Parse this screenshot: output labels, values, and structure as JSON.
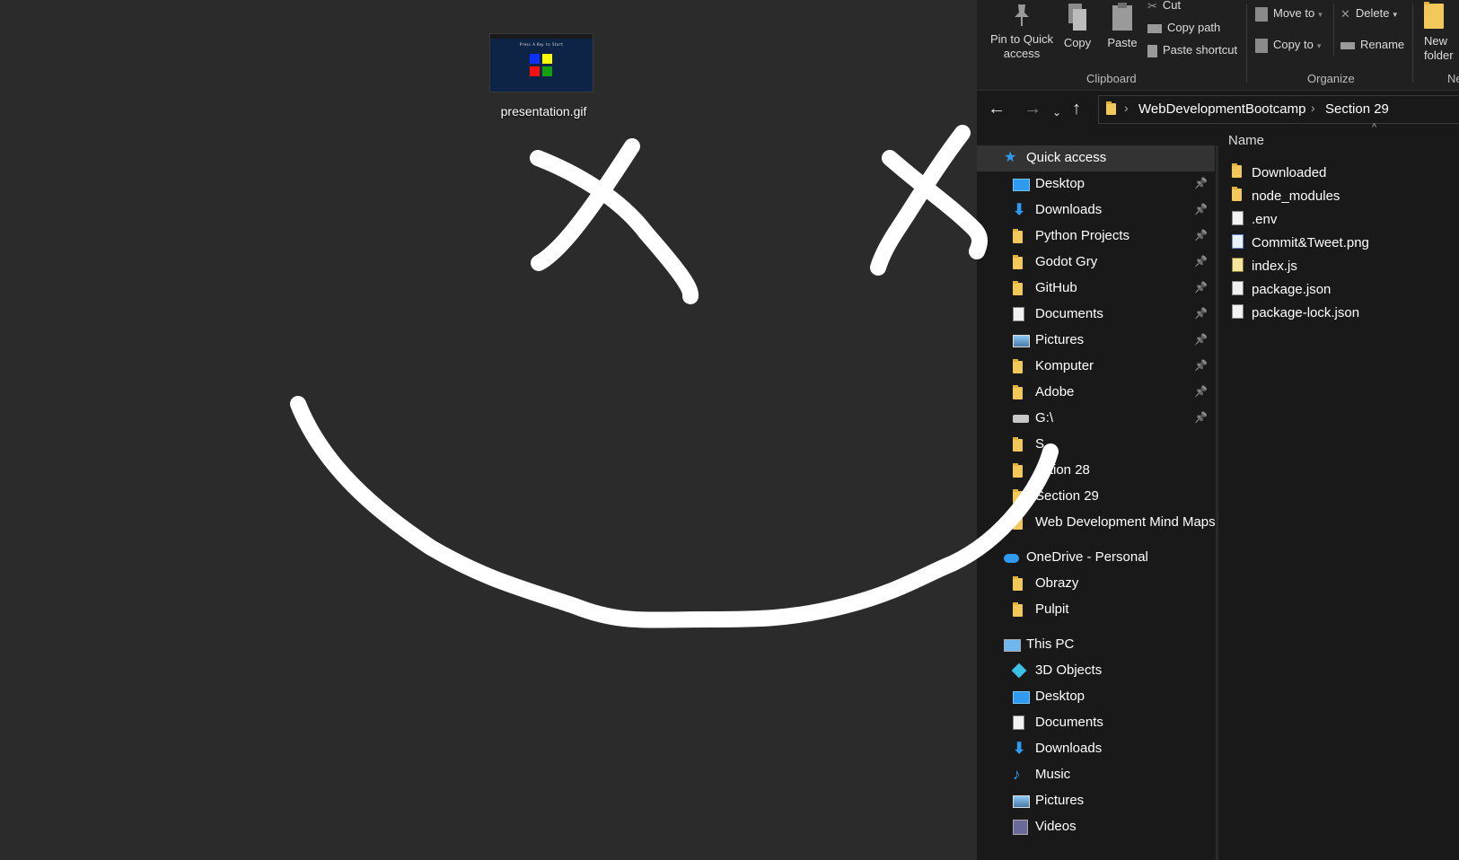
{
  "desktop": {
    "file_name": "presentation.gif",
    "thumbnail_caption": "Press A Key to Start"
  },
  "ribbon": {
    "pin_label": "Pin to Quick access",
    "copy_label": "Copy",
    "paste_label": "Paste",
    "cut_label": "Cut",
    "copy_path_label": "Copy path",
    "paste_shortcut_label": "Paste shortcut",
    "clipboard_group": "Clipboard",
    "move_to_label": "Move to",
    "copy_to_label": "Copy to",
    "delete_label": "Delete",
    "rename_label": "Rename",
    "organize_group": "Organize",
    "new_folder_label": "New folder",
    "new_group": "Ne"
  },
  "address": {
    "crumbs": [
      "WebDevelopmentBootcamp",
      "Section 29"
    ]
  },
  "nav": {
    "quick_access": "Quick access",
    "quick_items": [
      {
        "label": "Desktop",
        "icon": "desktop-icon"
      },
      {
        "label": "Downloads",
        "icon": "download-icon"
      },
      {
        "label": "Python Projects",
        "icon": "folder-icon"
      },
      {
        "label": "Godot Gry",
        "icon": "folder-icon"
      },
      {
        "label": "GitHub",
        "icon": "folder-icon"
      },
      {
        "label": "Documents",
        "icon": "documents-icon"
      },
      {
        "label": "Pictures",
        "icon": "pictures-icon"
      },
      {
        "label": "Komputer",
        "icon": "folder-icon"
      },
      {
        "label": "Adobe",
        "icon": "folder-icon"
      },
      {
        "label": "G:\\",
        "icon": "drive-icon"
      },
      {
        "label": "S",
        "icon": "folder-icon"
      },
      {
        "label": "ection 28",
        "icon": "folder-icon"
      },
      {
        "label": "Section 29",
        "icon": "folder-icon"
      },
      {
        "label": "Web Development Mind Maps",
        "icon": "folder-icon"
      }
    ],
    "onedrive": "OneDrive - Personal",
    "onedrive_items": [
      "Obrazy",
      "Pulpit"
    ],
    "this_pc": "This PC",
    "pc_items": [
      {
        "label": "3D Objects",
        "icon": "3d-objects-icon"
      },
      {
        "label": "Desktop",
        "icon": "desktop-icon"
      },
      {
        "label": "Documents",
        "icon": "documents-icon"
      },
      {
        "label": "Downloads",
        "icon": "download-icon"
      },
      {
        "label": "Music",
        "icon": "music-icon"
      },
      {
        "label": "Pictures",
        "icon": "pictures-icon"
      },
      {
        "label": "Videos",
        "icon": "videos-icon"
      }
    ]
  },
  "files": {
    "column": "Name",
    "items": [
      {
        "name": "Downloaded",
        "icon": "folder-icon"
      },
      {
        "name": "node_modules",
        "icon": "folder-icon"
      },
      {
        "name": ".env",
        "icon": "text-file-icon"
      },
      {
        "name": "Commit&Tweet.png",
        "icon": "image-file-icon"
      },
      {
        "name": "index.js",
        "icon": "js-file-icon"
      },
      {
        "name": "package.json",
        "icon": "json-file-icon"
      },
      {
        "name": "package-lock.json",
        "icon": "json-file-icon"
      }
    ]
  },
  "colors": {
    "desktop_bg": "#2b2b2b",
    "explorer_bg": "#191919",
    "folder": "#f3c85b",
    "accent_blue": "#2e9bf0"
  }
}
